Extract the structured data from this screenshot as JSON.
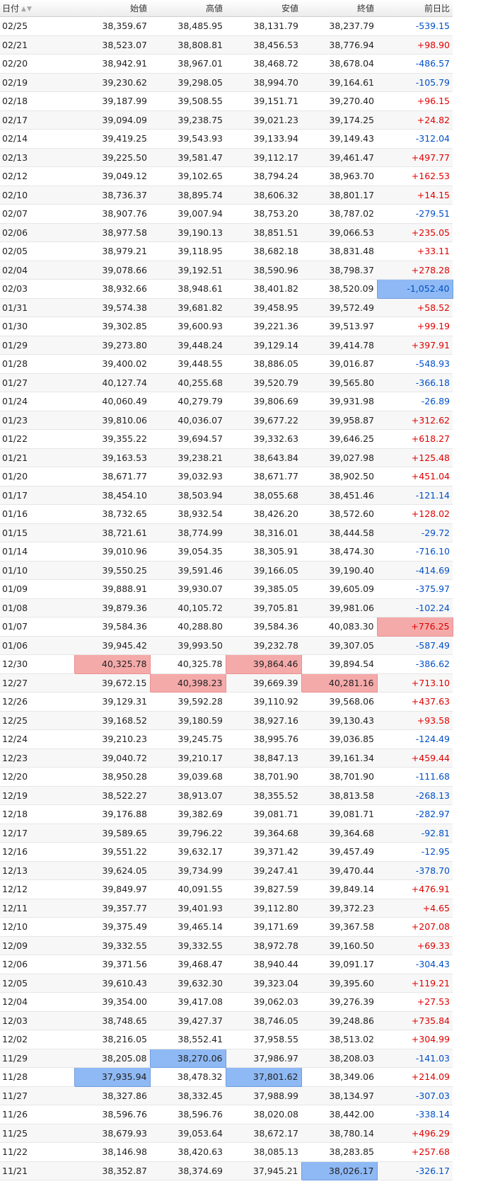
{
  "headers": {
    "date": "日付",
    "open": "始値",
    "high": "高値",
    "low": "安値",
    "close": "終値",
    "change": "前日比",
    "sort_up": "▲",
    "sort_down": "▼"
  },
  "colors": {
    "positive": "#e00000",
    "negative": "#0050c8",
    "highlight_red": "#f5aaaa",
    "highlight_blue": "#8fb9f4"
  },
  "rows": [
    {
      "date": "02/25",
      "open": "38,359.67",
      "high": "38,485.95",
      "low": "38,131.79",
      "close": "38,237.79",
      "change": "-539.15"
    },
    {
      "date": "02/21",
      "open": "38,523.07",
      "high": "38,808.81",
      "low": "38,456.53",
      "close": "38,776.94",
      "change": "+98.90"
    },
    {
      "date": "02/20",
      "open": "38,942.91",
      "high": "38,967.01",
      "low": "38,468.72",
      "close": "38,678.04",
      "change": "-486.57"
    },
    {
      "date": "02/19",
      "open": "39,230.62",
      "high": "39,298.05",
      "low": "38,994.70",
      "close": "39,164.61",
      "change": "-105.79"
    },
    {
      "date": "02/18",
      "open": "39,187.99",
      "high": "39,508.55",
      "low": "39,151.71",
      "close": "39,270.40",
      "change": "+96.15"
    },
    {
      "date": "02/17",
      "open": "39,094.09",
      "high": "39,238.75",
      "low": "39,021.23",
      "close": "39,174.25",
      "change": "+24.82"
    },
    {
      "date": "02/14",
      "open": "39,419.25",
      "high": "39,543.93",
      "low": "39,133.94",
      "close": "39,149.43",
      "change": "-312.04"
    },
    {
      "date": "02/13",
      "open": "39,225.50",
      "high": "39,581.47",
      "low": "39,112.17",
      "close": "39,461.47",
      "change": "+497.77"
    },
    {
      "date": "02/12",
      "open": "39,049.12",
      "high": "39,102.65",
      "low": "38,794.24",
      "close": "38,963.70",
      "change": "+162.53"
    },
    {
      "date": "02/10",
      "open": "38,736.37",
      "high": "38,895.74",
      "low": "38,606.32",
      "close": "38,801.17",
      "change": "+14.15"
    },
    {
      "date": "02/07",
      "open": "38,907.76",
      "high": "39,007.94",
      "low": "38,753.20",
      "close": "38,787.02",
      "change": "-279.51"
    },
    {
      "date": "02/06",
      "open": "38,977.58",
      "high": "39,190.13",
      "low": "38,851.51",
      "close": "39,066.53",
      "change": "+235.05"
    },
    {
      "date": "02/05",
      "open": "38,979.21",
      "high": "39,118.95",
      "low": "38,682.18",
      "close": "38,831.48",
      "change": "+33.11"
    },
    {
      "date": "02/04",
      "open": "39,078.66",
      "high": "39,192.51",
      "low": "38,590.96",
      "close": "38,798.37",
      "change": "+278.28"
    },
    {
      "date": "02/03",
      "open": "38,932.66",
      "high": "38,948.61",
      "low": "38,401.82",
      "close": "38,520.09",
      "change": "-1,052.40",
      "hl": {
        "change": "blue"
      }
    },
    {
      "date": "01/31",
      "open": "39,574.38",
      "high": "39,681.82",
      "low": "39,458.95",
      "close": "39,572.49",
      "change": "+58.52"
    },
    {
      "date": "01/30",
      "open": "39,302.85",
      "high": "39,600.93",
      "low": "39,221.36",
      "close": "39,513.97",
      "change": "+99.19"
    },
    {
      "date": "01/29",
      "open": "39,273.80",
      "high": "39,448.24",
      "low": "39,129.14",
      "close": "39,414.78",
      "change": "+397.91"
    },
    {
      "date": "01/28",
      "open": "39,400.02",
      "high": "39,448.55",
      "low": "38,886.05",
      "close": "39,016.87",
      "change": "-548.93"
    },
    {
      "date": "01/27",
      "open": "40,127.74",
      "high": "40,255.68",
      "low": "39,520.79",
      "close": "39,565.80",
      "change": "-366.18"
    },
    {
      "date": "01/24",
      "open": "40,060.49",
      "high": "40,279.79",
      "low": "39,806.69",
      "close": "39,931.98",
      "change": "-26.89"
    },
    {
      "date": "01/23",
      "open": "39,810.06",
      "high": "40,036.07",
      "low": "39,677.22",
      "close": "39,958.87",
      "change": "+312.62"
    },
    {
      "date": "01/22",
      "open": "39,355.22",
      "high": "39,694.57",
      "low": "39,332.63",
      "close": "39,646.25",
      "change": "+618.27"
    },
    {
      "date": "01/21",
      "open": "39,163.53",
      "high": "39,238.21",
      "low": "38,643.84",
      "close": "39,027.98",
      "change": "+125.48"
    },
    {
      "date": "01/20",
      "open": "38,671.77",
      "high": "39,032.93",
      "low": "38,671.77",
      "close": "38,902.50",
      "change": "+451.04"
    },
    {
      "date": "01/17",
      "open": "38,454.10",
      "high": "38,503.94",
      "low": "38,055.68",
      "close": "38,451.46",
      "change": "-121.14"
    },
    {
      "date": "01/16",
      "open": "38,732.65",
      "high": "38,932.54",
      "low": "38,426.20",
      "close": "38,572.60",
      "change": "+128.02"
    },
    {
      "date": "01/15",
      "open": "38,721.61",
      "high": "38,774.99",
      "low": "38,316.01",
      "close": "38,444.58",
      "change": "-29.72"
    },
    {
      "date": "01/14",
      "open": "39,010.96",
      "high": "39,054.35",
      "low": "38,305.91",
      "close": "38,474.30",
      "change": "-716.10"
    },
    {
      "date": "01/10",
      "open": "39,550.25",
      "high": "39,591.46",
      "low": "39,166.05",
      "close": "39,190.40",
      "change": "-414.69"
    },
    {
      "date": "01/09",
      "open": "39,888.91",
      "high": "39,930.07",
      "low": "39,385.05",
      "close": "39,605.09",
      "change": "-375.97"
    },
    {
      "date": "01/08",
      "open": "39,879.36",
      "high": "40,105.72",
      "low": "39,705.81",
      "close": "39,981.06",
      "change": "-102.24"
    },
    {
      "date": "01/07",
      "open": "39,584.36",
      "high": "40,288.80",
      "low": "39,584.36",
      "close": "40,083.30",
      "change": "+776.25",
      "hl": {
        "change": "red"
      }
    },
    {
      "date": "01/06",
      "open": "39,945.42",
      "high": "39,993.50",
      "low": "39,232.78",
      "close": "39,307.05",
      "change": "-587.49"
    },
    {
      "date": "12/30",
      "open": "40,325.78",
      "high": "40,325.78",
      "low": "39,864.46",
      "close": "39,894.54",
      "change": "-386.62",
      "hl": {
        "open": "red",
        "low": "red"
      }
    },
    {
      "date": "12/27",
      "open": "39,672.15",
      "high": "40,398.23",
      "low": "39,669.39",
      "close": "40,281.16",
      "change": "+713.10",
      "hl": {
        "high": "red",
        "close": "red"
      }
    },
    {
      "date": "12/26",
      "open": "39,129.31",
      "high": "39,592.28",
      "low": "39,110.92",
      "close": "39,568.06",
      "change": "+437.63"
    },
    {
      "date": "12/25",
      "open": "39,168.52",
      "high": "39,180.59",
      "low": "38,927.16",
      "close": "39,130.43",
      "change": "+93.58"
    },
    {
      "date": "12/24",
      "open": "39,210.23",
      "high": "39,245.75",
      "low": "38,995.76",
      "close": "39,036.85",
      "change": "-124.49"
    },
    {
      "date": "12/23",
      "open": "39,040.72",
      "high": "39,210.17",
      "low": "38,847.13",
      "close": "39,161.34",
      "change": "+459.44"
    },
    {
      "date": "12/20",
      "open": "38,950.28",
      "high": "39,039.68",
      "low": "38,701.90",
      "close": "38,701.90",
      "change": "-111.68"
    },
    {
      "date": "12/19",
      "open": "38,522.27",
      "high": "38,913.07",
      "low": "38,355.52",
      "close": "38,813.58",
      "change": "-268.13"
    },
    {
      "date": "12/18",
      "open": "39,176.88",
      "high": "39,382.69",
      "low": "39,081.71",
      "close": "39,081.71",
      "change": "-282.97"
    },
    {
      "date": "12/17",
      "open": "39,589.65",
      "high": "39,796.22",
      "low": "39,364.68",
      "close": "39,364.68",
      "change": "-92.81"
    },
    {
      "date": "12/16",
      "open": "39,551.22",
      "high": "39,632.17",
      "low": "39,371.42",
      "close": "39,457.49",
      "change": "-12.95"
    },
    {
      "date": "12/13",
      "open": "39,624.05",
      "high": "39,734.99",
      "low": "39,247.41",
      "close": "39,470.44",
      "change": "-378.70"
    },
    {
      "date": "12/12",
      "open": "39,849.97",
      "high": "40,091.55",
      "low": "39,827.59",
      "close": "39,849.14",
      "change": "+476.91"
    },
    {
      "date": "12/11",
      "open": "39,357.77",
      "high": "39,401.93",
      "low": "39,112.80",
      "close": "39,372.23",
      "change": "+4.65"
    },
    {
      "date": "12/10",
      "open": "39,375.49",
      "high": "39,465.14",
      "low": "39,171.69",
      "close": "39,367.58",
      "change": "+207.08"
    },
    {
      "date": "12/09",
      "open": "39,332.55",
      "high": "39,332.55",
      "low": "38,972.78",
      "close": "39,160.50",
      "change": "+69.33"
    },
    {
      "date": "12/06",
      "open": "39,371.56",
      "high": "39,468.47",
      "low": "38,940.44",
      "close": "39,091.17",
      "change": "-304.43"
    },
    {
      "date": "12/05",
      "open": "39,610.43",
      "high": "39,632.30",
      "low": "39,323.04",
      "close": "39,395.60",
      "change": "+119.21"
    },
    {
      "date": "12/04",
      "open": "39,354.00",
      "high": "39,417.08",
      "low": "39,062.03",
      "close": "39,276.39",
      "change": "+27.53"
    },
    {
      "date": "12/03",
      "open": "38,748.65",
      "high": "39,427.37",
      "low": "38,746.05",
      "close": "39,248.86",
      "change": "+735.84"
    },
    {
      "date": "12/02",
      "open": "38,216.05",
      "high": "38,552.41",
      "low": "37,958.55",
      "close": "38,513.02",
      "change": "+304.99"
    },
    {
      "date": "11/29",
      "open": "38,205.08",
      "high": "38,270.06",
      "low": "37,986.97",
      "close": "38,208.03",
      "change": "-141.03",
      "hl": {
        "high": "blue"
      }
    },
    {
      "date": "11/28",
      "open": "37,935.94",
      "high": "38,478.32",
      "low": "37,801.62",
      "close": "38,349.06",
      "change": "+214.09",
      "hl": {
        "open": "blue",
        "low": "blue"
      }
    },
    {
      "date": "11/27",
      "open": "38,327.86",
      "high": "38,332.45",
      "low": "37,988.99",
      "close": "38,134.97",
      "change": "-307.03"
    },
    {
      "date": "11/26",
      "open": "38,596.76",
      "high": "38,596.76",
      "low": "38,020.08",
      "close": "38,442.00",
      "change": "-338.14"
    },
    {
      "date": "11/25",
      "open": "38,679.93",
      "high": "39,053.64",
      "low": "38,672.17",
      "close": "38,780.14",
      "change": "+496.29"
    },
    {
      "date": "11/22",
      "open": "38,146.98",
      "high": "38,420.63",
      "low": "38,085.13",
      "close": "38,283.85",
      "change": "+257.68"
    },
    {
      "date": "11/21",
      "open": "38,352.87",
      "high": "38,374.69",
      "low": "37,945.21",
      "close": "38,026.17",
      "change": "-326.17",
      "hl": {
        "close": "blue"
      }
    }
  ]
}
